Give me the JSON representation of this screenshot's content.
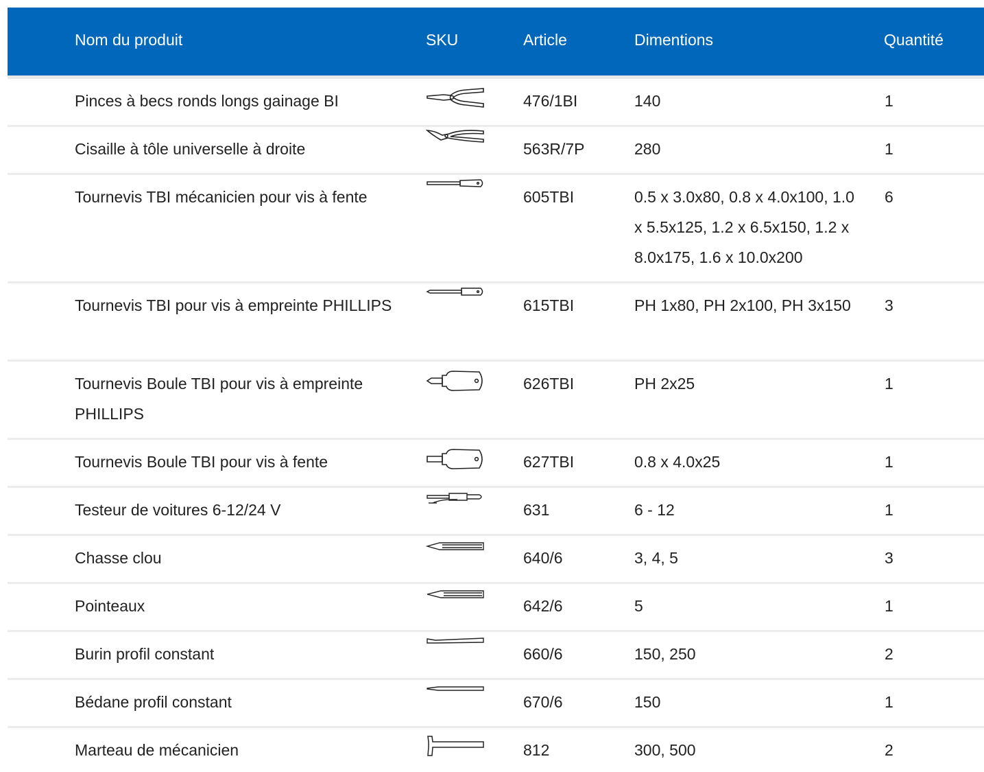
{
  "table": {
    "headers": {
      "name": "Nom du produit",
      "sku": "SKU",
      "article": "Article",
      "dims": "Dimentions",
      "qty": "Quantité"
    },
    "rows": [
      {
        "name": "Pinces à becs ronds longs gainage BI",
        "icon": "pliers-icon",
        "article": "476/1BI",
        "dims": "140",
        "qty": "1"
      },
      {
        "name": "Cisaille à tôle universelle à droite",
        "icon": "tin-snips-icon",
        "article": "563R/7P",
        "dims": "280",
        "qty": "1"
      },
      {
        "name": "Tournevis TBI mécanicien pour vis à fente",
        "icon": "slotted-screwdriver-icon",
        "article": "605TBI",
        "dims": "0.5 x 3.0x80, 0.8 x 4.0x100, 1.0 x 5.5x125, 1.2 x 6.5x150, 1.2 x 8.0x175, 1.6 x 10.0x200",
        "qty": "6"
      },
      {
        "name": "Tournevis TBI pour vis à empreinte PHILLIPS",
        "icon": "phillips-screwdriver-icon",
        "article": "615TBI",
        "dims": "PH 1x80, PH 2x100, PH 3x150",
        "qty": "3"
      },
      {
        "name": "Tournevis Boule TBI pour vis à empreinte PHILLIPS",
        "icon": "stubby-phillips-screwdriver-icon",
        "article": "626TBI",
        "dims": "PH 2x25",
        "qty": "1"
      },
      {
        "name": "Tournevis Boule TBI pour vis à fente",
        "icon": "stubby-slotted-screwdriver-icon",
        "article": "627TBI",
        "dims": "0.8 x 4.0x25",
        "qty": "1"
      },
      {
        "name": "Testeur de voitures 6-12/24 V",
        "icon": "circuit-tester-icon",
        "article": "631",
        "dims": "6 - 12",
        "qty": "1"
      },
      {
        "name": "Chasse clou",
        "icon": "nail-punch-icon",
        "article": "640/6",
        "dims": "3, 4, 5",
        "qty": "3"
      },
      {
        "name": "Pointeaux",
        "icon": "center-punch-icon",
        "article": "642/6",
        "dims": "5",
        "qty": "1"
      },
      {
        "name": "Burin profil constant",
        "icon": "flat-chisel-icon",
        "article": "660/6",
        "dims": "150, 250",
        "qty": "2"
      },
      {
        "name": "Bédane profil constant",
        "icon": "cape-chisel-icon",
        "article": "670/6",
        "dims": "150",
        "qty": "1"
      },
      {
        "name": "Marteau de mécanicien",
        "icon": "hammer-icon",
        "article": "812",
        "dims": "300, 500",
        "qty": "2"
      }
    ]
  }
}
